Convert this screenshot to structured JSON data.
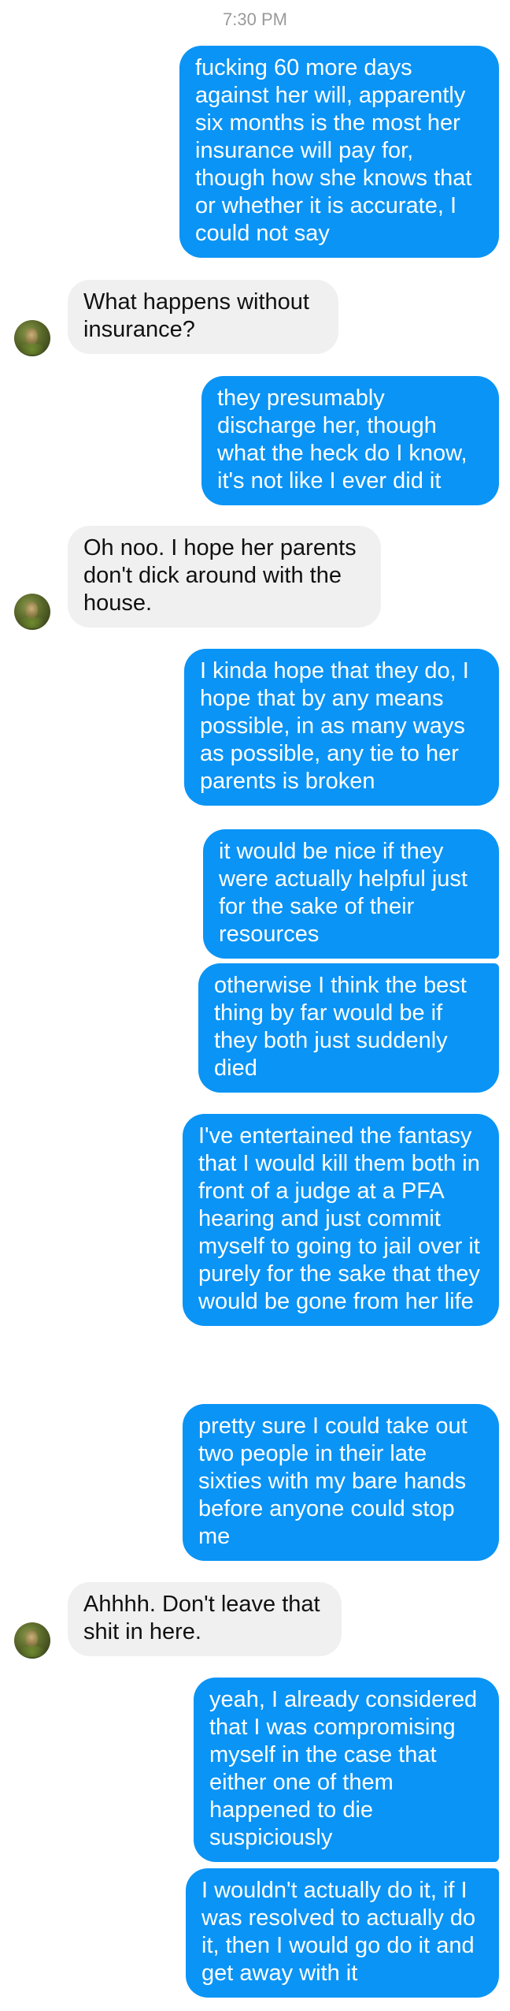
{
  "timestamp": "7:30 PM",
  "messages": [
    {
      "direction": "outgoing",
      "text": "fucking 60 more days against her will, apparently six months is the most her insurance will pay for, though how she knows that or whether it is accurate, I could not say"
    },
    {
      "direction": "incoming",
      "text": "What happens without insurance?"
    },
    {
      "direction": "outgoing",
      "text": "they presumably discharge her, though what the heck do I know, it's not like I ever did it"
    },
    {
      "direction": "incoming",
      "text": "Oh noo. I hope her parents don't dick around with the house."
    },
    {
      "direction": "outgoing",
      "text": "I kinda hope that they do, I hope that by any means possible, in as many ways as possible, any tie to her parents is broken"
    },
    {
      "direction": "outgoing",
      "text": "it would be nice if they were actually helpful just for the sake of their resources"
    },
    {
      "direction": "outgoing",
      "text": "otherwise I think the best thing by far would be if they both just suddenly died"
    },
    {
      "direction": "outgoing",
      "text": "I've entertained the fantasy that I would kill them both in front of a judge at a PFA hearing and just commit myself to going to jail over it purely for the sake that they would be gone from her life"
    },
    {
      "direction": "outgoing",
      "text": "pretty sure I could take out two people in their late sixties with my bare hands before anyone could stop me"
    },
    {
      "direction": "incoming",
      "text": "Ahhhh. Don't leave that shit in here."
    },
    {
      "direction": "outgoing",
      "text": "yeah, I already considered that I was compromising myself in the case that either one of them happened to die suspiciously"
    },
    {
      "direction": "outgoing",
      "text": "I wouldn't actually do it, if I was resolved to actually do it, then I would go do it and get away with it"
    }
  ],
  "colors": {
    "outgoing_bubble": "#0a94f5",
    "incoming_bubble": "#f0f0f0",
    "timestamp": "#9a9a9a"
  },
  "icons": {
    "contact_avatar": "avatar-photo"
  }
}
